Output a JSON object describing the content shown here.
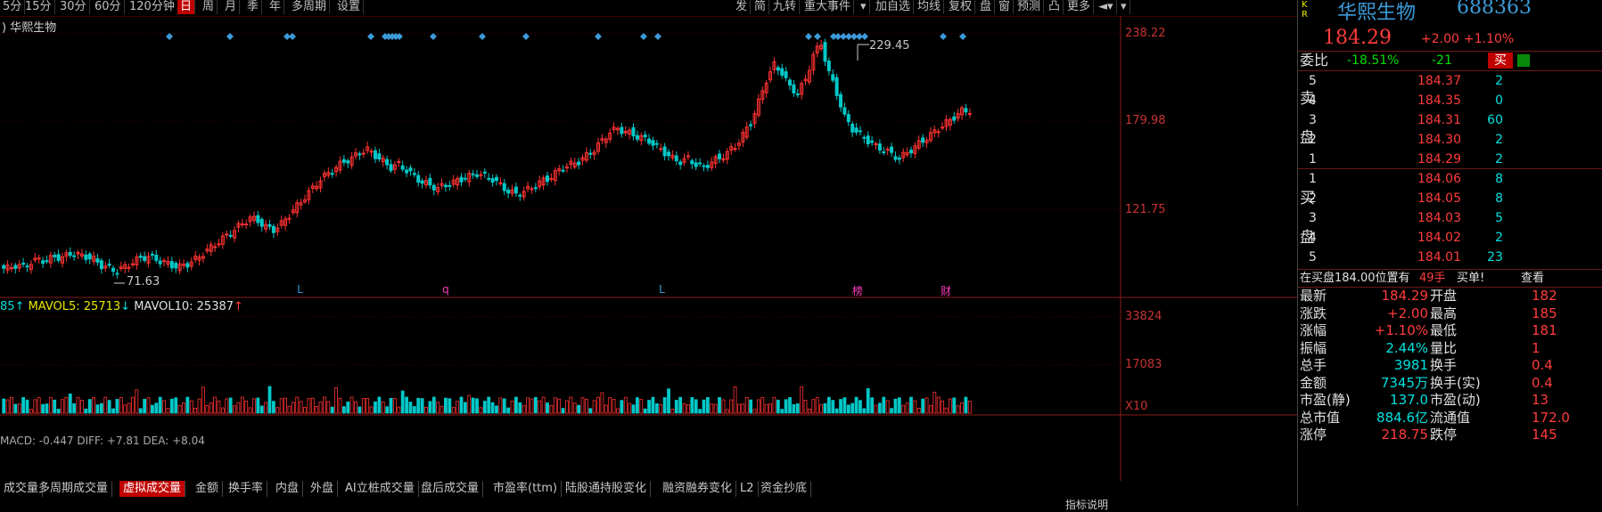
{
  "toolbar": {
    "left_items": [
      "5分",
      "15分",
      "30分",
      "60分",
      "120分钟",
      "日",
      "周",
      "月",
      "季",
      "年",
      "多周期",
      "设置"
    ],
    "active": "日",
    "right_items": [
      "发",
      "简",
      "九转",
      "重大事件",
      "▾",
      "加自选",
      "均线",
      "复权",
      "盘",
      "窗",
      "预测",
      "凸",
      "更多",
      "◄▾",
      "▾"
    ]
  },
  "chart": {
    "stock_label": "华熙生物",
    "price_axis": [
      "238.22",
      "179.98",
      "121.75"
    ],
    "volume_axis": [
      "33824",
      "17083"
    ],
    "volume_x10": "X10",
    "high_label": "229.45",
    "low_label": "71.63",
    "ma_line": {
      "prefix": "85↑",
      "mavol5": "MAVOL5: 25713",
      "mavol5_arrow": "↓",
      "mavol10": "MAVOL10: 25387",
      "mavol10_arrow": "↑"
    },
    "markers": [
      {
        "t": "L",
        "x": 0.229
      },
      {
        "t": "q",
        "x": 0.341
      },
      {
        "t": "L",
        "x": 0.508
      },
      {
        "t": "榜",
        "x": 0.657
      },
      {
        "t": "财",
        "x": 0.725
      }
    ],
    "macd_line": "MACD: -0.447 DIFF: +7.81 DEA: +8.04"
  },
  "chart_data": {
    "type": "candlestick",
    "price_range": [
      62,
      242
    ],
    "closes": [
      78,
      80,
      79,
      82,
      84,
      83,
      86,
      85,
      88,
      87,
      86,
      84,
      80,
      78,
      76,
      79,
      82,
      85,
      86,
      84,
      82,
      80,
      79,
      81,
      84,
      88,
      92,
      96,
      100,
      104,
      108,
      112,
      110,
      106,
      104,
      108,
      114,
      120,
      126,
      132,
      138,
      142,
      146,
      150,
      152,
      156,
      158,
      154,
      150,
      146,
      148,
      144,
      140,
      136,
      134,
      132,
      134,
      136,
      138,
      140,
      142,
      140,
      138,
      134,
      130,
      128,
      130,
      132,
      136,
      138,
      142,
      146,
      148,
      150,
      154,
      158,
      164,
      170,
      172,
      170,
      168,
      166,
      164,
      160,
      156,
      152,
      150,
      152,
      148,
      146,
      150,
      152,
      156,
      160,
      168,
      176,
      190,
      205,
      215,
      210,
      200,
      196,
      205,
      222,
      229,
      210,
      196,
      180,
      172,
      168,
      164,
      160,
      158,
      155,
      152,
      156,
      160,
      164,
      168,
      172,
      176,
      180,
      184,
      184.29
    ]
  },
  "panel": {
    "kr": "K R",
    "name": "华熙生物",
    "code": "688363",
    "price": "184.29",
    "change": "+2.00",
    "change_pct": "+1.10%",
    "weibi_label": "委比",
    "weibi_pct": "-18.51%",
    "weibi_num": "-21",
    "buy_btn": "买",
    "sell_label": "卖\n\n盘",
    "buy_label": "买\n\n盘",
    "asks": [
      {
        "lv": "5",
        "price": "184.37",
        "vol": "2"
      },
      {
        "lv": "4",
        "price": "184.35",
        "vol": "0"
      },
      {
        "lv": "3",
        "price": "184.31",
        "vol": "60"
      },
      {
        "lv": "2",
        "price": "184.30",
        "vol": "2"
      },
      {
        "lv": "1",
        "price": "184.29",
        "vol": "2"
      }
    ],
    "bids": [
      {
        "lv": "1",
        "price": "184.06",
        "vol": "8"
      },
      {
        "lv": "2",
        "price": "184.05",
        "vol": "8"
      },
      {
        "lv": "3",
        "price": "184.03",
        "vol": "5"
      },
      {
        "lv": "4",
        "price": "184.02",
        "vol": "2"
      },
      {
        "lv": "5",
        "price": "184.01",
        "vol": "23"
      }
    ],
    "notice": "在买盘184.00位置有",
    "notice_qty": "49手",
    "notice_act": "买单!",
    "notice_link": "查看",
    "stats": [
      {
        "l": "最新",
        "v": "184.29",
        "r": "开盘",
        "rv": "182"
      },
      {
        "l": "涨跌",
        "v": "+2.00",
        "r": "最高",
        "rv": "185"
      },
      {
        "l": "涨幅",
        "v": "+1.10%",
        "r": "最低",
        "rv": "181"
      },
      {
        "l": "振幅",
        "v": "2.44%",
        "r": "量比",
        "rv": "1"
      },
      {
        "l": "总手",
        "v": "3981",
        "r": "换手",
        "rv": "0.4"
      },
      {
        "l": "金额",
        "v": "7345万",
        "r": "换手(实)",
        "rv": "0.4"
      },
      {
        "l": "市盈(静)",
        "v": "137.0",
        "r": "市盈(动)",
        "rv": "13"
      },
      {
        "l": "总市值",
        "v": "884.6亿",
        "r": "流通值",
        "rv": "172.0"
      },
      {
        "l": "涨停",
        "v": "218.75",
        "r": "跌停",
        "rv": "145"
      }
    ]
  },
  "tabs": [
    "成交量",
    "多周期成交量",
    "虚拟成交量",
    "金额",
    "换手率",
    "内盘",
    "外盘",
    "AI立桩成交量",
    "盘后成交量",
    "市盈率(ttm)",
    "陆股通持股变化",
    "融资融券变化",
    "L2",
    "资金抄底"
  ],
  "active_tab": "虚拟成交量",
  "bottom_right": "指标说明"
}
